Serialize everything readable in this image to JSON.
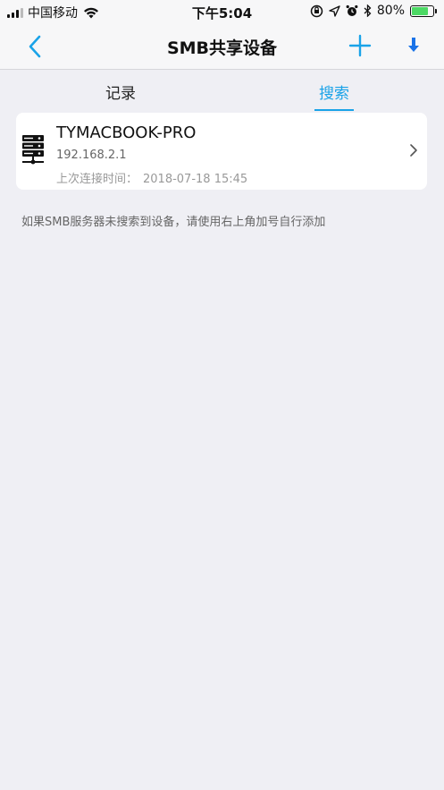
{
  "status_bar": {
    "carrier": "中国移动",
    "time": "下午5:04",
    "battery": "80%",
    "battery_level": 0.8
  },
  "nav": {
    "title": "SMB共享设备"
  },
  "tabs": {
    "records": "记录",
    "search": "搜索"
  },
  "device": {
    "name": "TYMACBOOK-PRO",
    "ip": "192.168.2.1",
    "last_label": "上次连接时间：",
    "last_value": "2018-07-18 15:45"
  },
  "hint": "如果SMB服务器未搜索到设备，请使用右上角加号自行添加",
  "colors": {
    "accent": "#1aa3e8",
    "battery": "#4cd964"
  }
}
